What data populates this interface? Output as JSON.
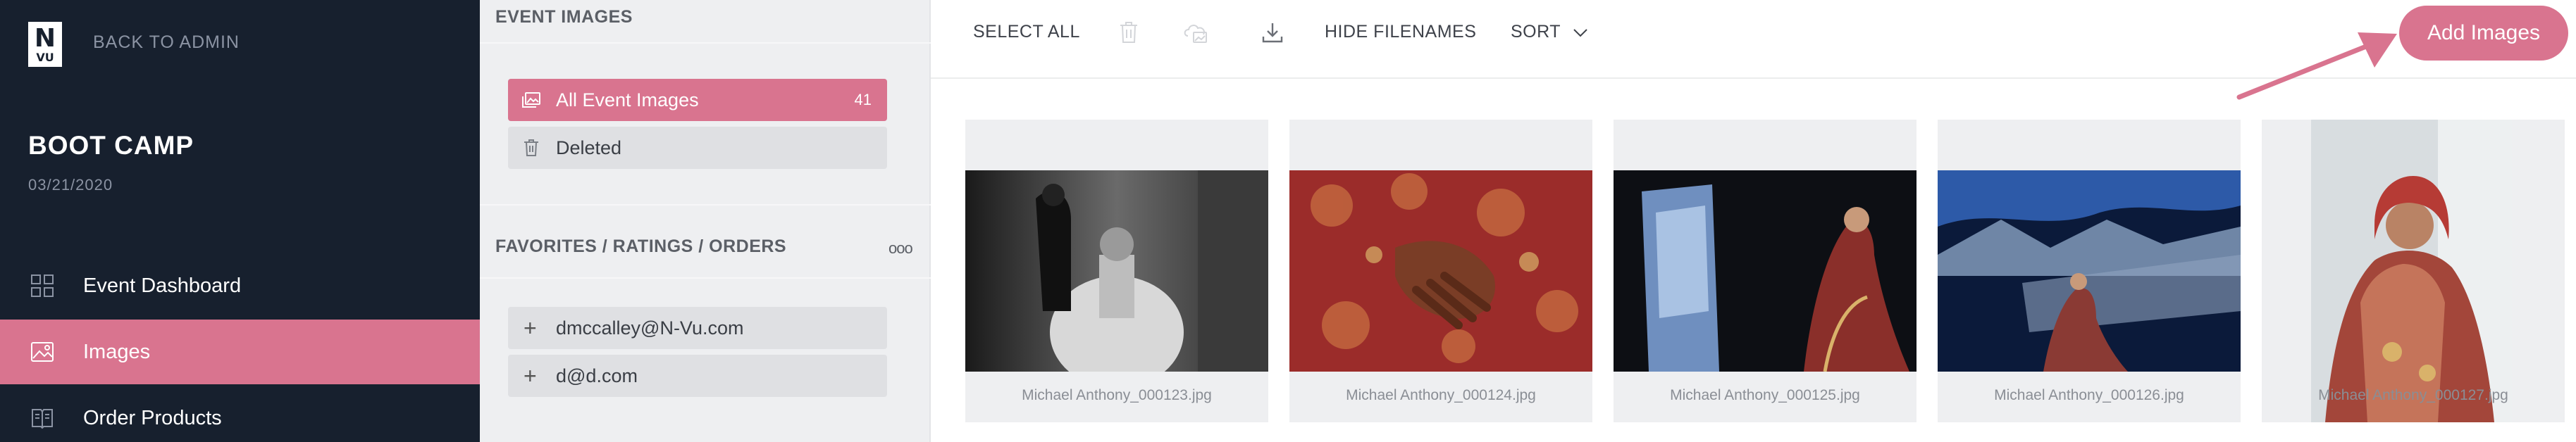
{
  "app": {
    "logo_text_top": "N",
    "logo_text_bottom": "VU",
    "back_label": "BACK TO ADMIN"
  },
  "event": {
    "title": "BOOT CAMP",
    "date": "03/21/2020"
  },
  "nav": [
    {
      "label": "Event Dashboard",
      "icon": "grid-icon"
    },
    {
      "label": "Images",
      "icon": "image-icon",
      "active": true
    },
    {
      "label": "Order Products",
      "icon": "book-icon"
    }
  ],
  "panel": {
    "event_images_heading": "EVENT IMAGES",
    "albums": [
      {
        "label": "All Event Images",
        "count": "41",
        "icon": "images-icon",
        "active": true
      },
      {
        "label": "Deleted",
        "icon": "trash-icon"
      }
    ],
    "favorites_heading": "FAVORITES / RATINGS / ORDERS",
    "more_label": "ooo",
    "favorites": [
      {
        "label": "dmccalley@N-Vu.com"
      },
      {
        "label": "d@d.com"
      }
    ]
  },
  "toolbar": {
    "select_all": "SELECT ALL",
    "hide_filenames": "HIDE FILENAMES",
    "sort": "SORT",
    "add_images": "Add Images"
  },
  "images": [
    {
      "filename": "Michael Anthony_000123.jpg"
    },
    {
      "filename": "Michael Anthony_000124.jpg"
    },
    {
      "filename": "Michael Anthony_000125.jpg"
    },
    {
      "filename": "Michael Anthony_000126.jpg"
    },
    {
      "filename": "Michael Anthony_000127.jpg"
    }
  ],
  "colors": {
    "accent": "#d9748f",
    "sidebar_bg": "#17202e",
    "panel_bg": "#eeeff1"
  }
}
